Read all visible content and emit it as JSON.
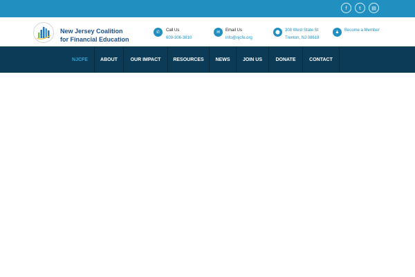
{
  "social": {
    "items": [
      {
        "icon": "facebook-icon",
        "glyph": "f"
      },
      {
        "icon": "twitter-icon",
        "glyph": "t"
      },
      {
        "icon": "calendar-icon",
        "glyph": "▤"
      }
    ]
  },
  "logo": {
    "line1": "New Jersey Coalition",
    "line2": "for Financial Education"
  },
  "contact": {
    "call_title": "Call Us",
    "call_value": "609-306-3810",
    "email_title": "Email Us",
    "email_value": "info@njcfe.org",
    "address_line1": "308 West State St",
    "address_line2": "Trenton, NJ 08618",
    "member_label": "Become a Member"
  },
  "nav": {
    "items": [
      "NJCFE",
      "ABOUT",
      "OUR IMPACT",
      "RESOURCES",
      "NEWS",
      "JOIN US",
      "DONATE",
      "CONTACT"
    ]
  },
  "colors": {
    "accent": "#2190c0",
    "nav_bg": "#0b3b56",
    "logo_text": "#1f4f8b"
  }
}
